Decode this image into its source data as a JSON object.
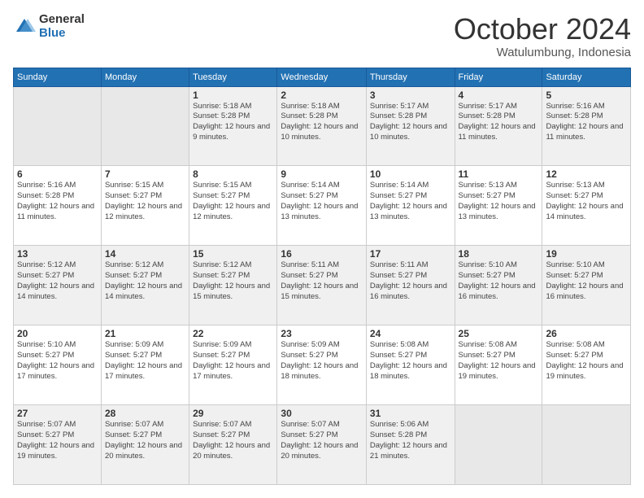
{
  "logo": {
    "general": "General",
    "blue": "Blue"
  },
  "header": {
    "month": "October 2024",
    "location": "Watulumbung, Indonesia"
  },
  "weekdays": [
    "Sunday",
    "Monday",
    "Tuesday",
    "Wednesday",
    "Thursday",
    "Friday",
    "Saturday"
  ],
  "weeks": [
    [
      {
        "day": "",
        "info": ""
      },
      {
        "day": "",
        "info": ""
      },
      {
        "day": "1",
        "info": "Sunrise: 5:18 AM\nSunset: 5:28 PM\nDaylight: 12 hours and 9 minutes."
      },
      {
        "day": "2",
        "info": "Sunrise: 5:18 AM\nSunset: 5:28 PM\nDaylight: 12 hours and 10 minutes."
      },
      {
        "day": "3",
        "info": "Sunrise: 5:17 AM\nSunset: 5:28 PM\nDaylight: 12 hours and 10 minutes."
      },
      {
        "day": "4",
        "info": "Sunrise: 5:17 AM\nSunset: 5:28 PM\nDaylight: 12 hours and 11 minutes."
      },
      {
        "day": "5",
        "info": "Sunrise: 5:16 AM\nSunset: 5:28 PM\nDaylight: 12 hours and 11 minutes."
      }
    ],
    [
      {
        "day": "6",
        "info": "Sunrise: 5:16 AM\nSunset: 5:28 PM\nDaylight: 12 hours and 11 minutes."
      },
      {
        "day": "7",
        "info": "Sunrise: 5:15 AM\nSunset: 5:27 PM\nDaylight: 12 hours and 12 minutes."
      },
      {
        "day": "8",
        "info": "Sunrise: 5:15 AM\nSunset: 5:27 PM\nDaylight: 12 hours and 12 minutes."
      },
      {
        "day": "9",
        "info": "Sunrise: 5:14 AM\nSunset: 5:27 PM\nDaylight: 12 hours and 13 minutes."
      },
      {
        "day": "10",
        "info": "Sunrise: 5:14 AM\nSunset: 5:27 PM\nDaylight: 12 hours and 13 minutes."
      },
      {
        "day": "11",
        "info": "Sunrise: 5:13 AM\nSunset: 5:27 PM\nDaylight: 12 hours and 13 minutes."
      },
      {
        "day": "12",
        "info": "Sunrise: 5:13 AM\nSunset: 5:27 PM\nDaylight: 12 hours and 14 minutes."
      }
    ],
    [
      {
        "day": "13",
        "info": "Sunrise: 5:12 AM\nSunset: 5:27 PM\nDaylight: 12 hours and 14 minutes."
      },
      {
        "day": "14",
        "info": "Sunrise: 5:12 AM\nSunset: 5:27 PM\nDaylight: 12 hours and 14 minutes."
      },
      {
        "day": "15",
        "info": "Sunrise: 5:12 AM\nSunset: 5:27 PM\nDaylight: 12 hours and 15 minutes."
      },
      {
        "day": "16",
        "info": "Sunrise: 5:11 AM\nSunset: 5:27 PM\nDaylight: 12 hours and 15 minutes."
      },
      {
        "day": "17",
        "info": "Sunrise: 5:11 AM\nSunset: 5:27 PM\nDaylight: 12 hours and 16 minutes."
      },
      {
        "day": "18",
        "info": "Sunrise: 5:10 AM\nSunset: 5:27 PM\nDaylight: 12 hours and 16 minutes."
      },
      {
        "day": "19",
        "info": "Sunrise: 5:10 AM\nSunset: 5:27 PM\nDaylight: 12 hours and 16 minutes."
      }
    ],
    [
      {
        "day": "20",
        "info": "Sunrise: 5:10 AM\nSunset: 5:27 PM\nDaylight: 12 hours and 17 minutes."
      },
      {
        "day": "21",
        "info": "Sunrise: 5:09 AM\nSunset: 5:27 PM\nDaylight: 12 hours and 17 minutes."
      },
      {
        "day": "22",
        "info": "Sunrise: 5:09 AM\nSunset: 5:27 PM\nDaylight: 12 hours and 17 minutes."
      },
      {
        "day": "23",
        "info": "Sunrise: 5:09 AM\nSunset: 5:27 PM\nDaylight: 12 hours and 18 minutes."
      },
      {
        "day": "24",
        "info": "Sunrise: 5:08 AM\nSunset: 5:27 PM\nDaylight: 12 hours and 18 minutes."
      },
      {
        "day": "25",
        "info": "Sunrise: 5:08 AM\nSunset: 5:27 PM\nDaylight: 12 hours and 19 minutes."
      },
      {
        "day": "26",
        "info": "Sunrise: 5:08 AM\nSunset: 5:27 PM\nDaylight: 12 hours and 19 minutes."
      }
    ],
    [
      {
        "day": "27",
        "info": "Sunrise: 5:07 AM\nSunset: 5:27 PM\nDaylight: 12 hours and 19 minutes."
      },
      {
        "day": "28",
        "info": "Sunrise: 5:07 AM\nSunset: 5:27 PM\nDaylight: 12 hours and 20 minutes."
      },
      {
        "day": "29",
        "info": "Sunrise: 5:07 AM\nSunset: 5:27 PM\nDaylight: 12 hours and 20 minutes."
      },
      {
        "day": "30",
        "info": "Sunrise: 5:07 AM\nSunset: 5:27 PM\nDaylight: 12 hours and 20 minutes."
      },
      {
        "day": "31",
        "info": "Sunrise: 5:06 AM\nSunset: 5:28 PM\nDaylight: 12 hours and 21 minutes."
      },
      {
        "day": "",
        "info": ""
      },
      {
        "day": "",
        "info": ""
      }
    ]
  ]
}
